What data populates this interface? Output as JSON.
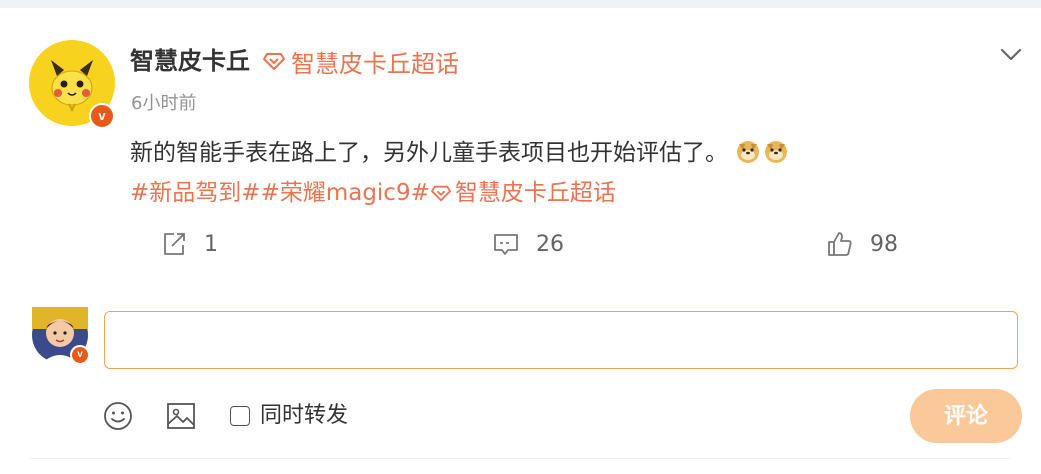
{
  "post": {
    "username": "智慧皮卡丘",
    "topic_badge": "智慧皮卡丘超话",
    "time": "6小时前",
    "text": "新的智能手表在路上了，另外儿童手表项目也开始评估了。",
    "emojis": [
      "doge-emoji",
      "doge-emoji"
    ],
    "tags": [
      "#新品驾到#",
      "#荣耀magic9#",
      "智慧皮卡丘超话"
    ]
  },
  "actions": {
    "repost_count": "1",
    "comment_count": "26",
    "like_count": "98"
  },
  "comment": {
    "placeholder": "",
    "sync_repost_label": "同时转发",
    "submit_label": "评论"
  },
  "colors": {
    "accent": "#eb7350",
    "verified_badge": "#e8591a",
    "submit_bg": "#fbc89a",
    "input_border": "#f0a35a"
  },
  "icons": {
    "menu": "chevron-down-icon",
    "repost": "repost-icon",
    "comment": "comment-icon",
    "like": "thumbs-up-icon",
    "emoji": "smiley-icon",
    "image": "image-icon",
    "topic": "diamond-icon"
  }
}
